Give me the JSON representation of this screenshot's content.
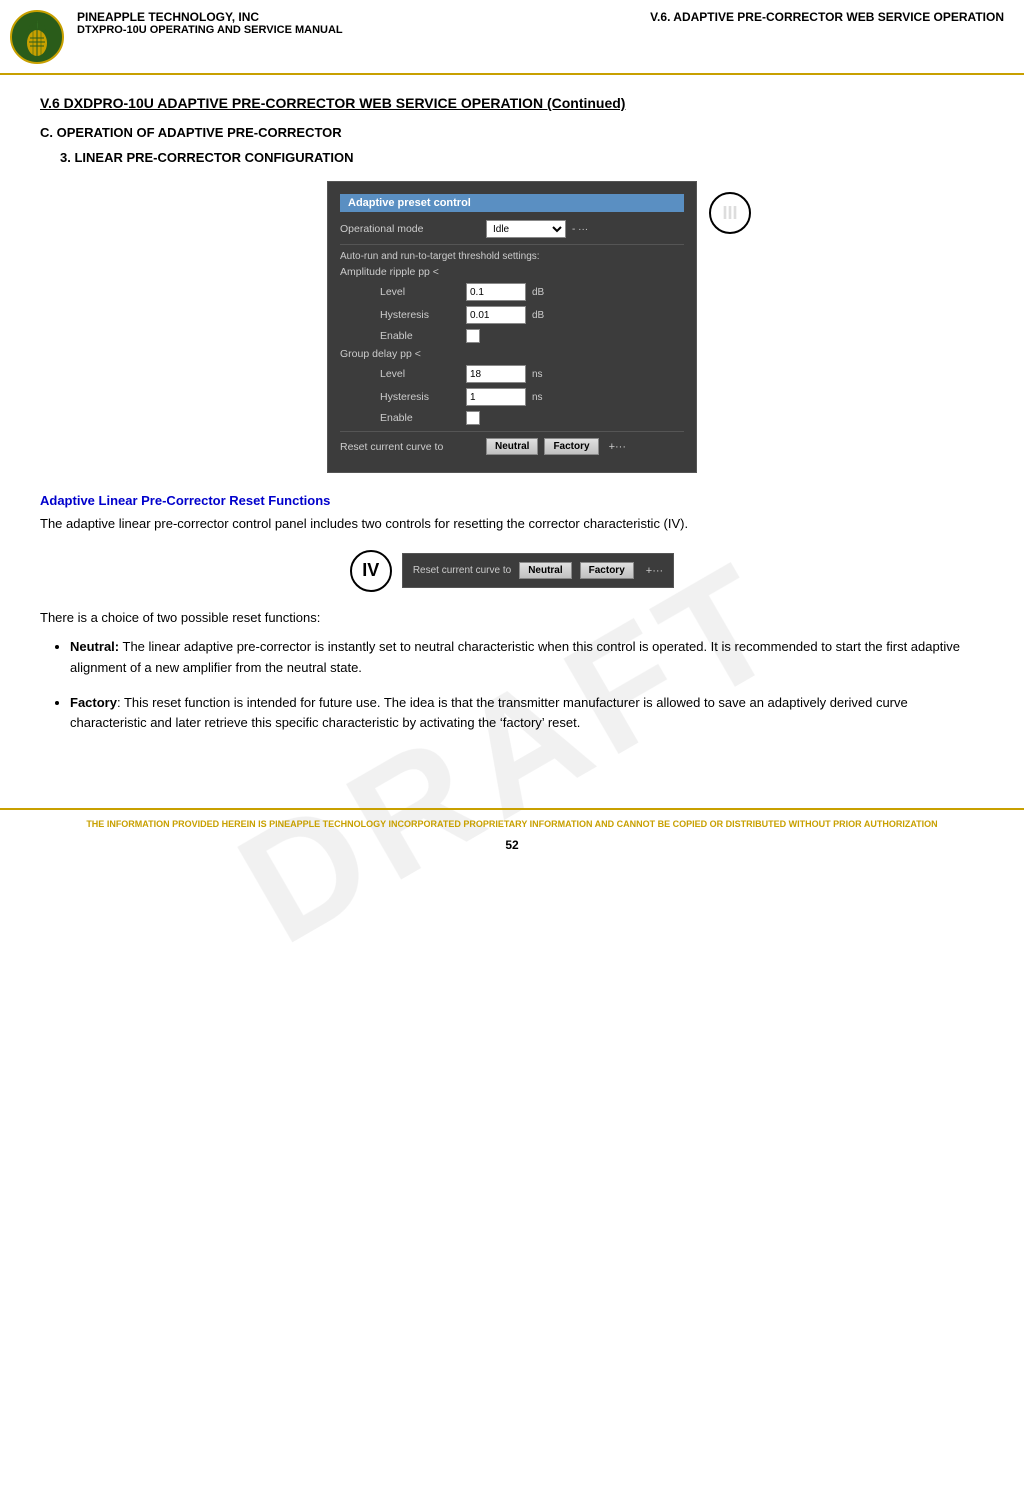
{
  "header": {
    "company": "PINEAPPLE TECHNOLOGY, INC",
    "chapter": "V.6. ADAPTIVE PRE-CORRECTOR WEB SERVICE OPERATION",
    "manual": "DTXPRO-10U OPERATING AND SERVICE MANUAL"
  },
  "section_title": "V.6  DXDPRO-10U ADAPTIVE PRE-CORRECTOR WEB SERVICE OPERATION (Continued)",
  "sub_section_c": "C.   OPERATION OF ADAPTIVE PRE-CORRECTOR",
  "sub_section_3": "3.  LINEAR PRE-CORRECTOR CONFIGURATION",
  "ui_panel": {
    "title": "Adaptive preset control",
    "operational_mode_label": "Operational mode",
    "operational_mode_value": "Idle",
    "autorun_label": "Auto-run and run-to-target threshold settings:",
    "amplitude_label": "Amplitude ripple pp <",
    "level_label": "Level",
    "amplitude_level_value": "0.1",
    "amplitude_level_unit": "dB",
    "hysteresis_label": "Hysteresis",
    "amplitude_hysteresis_value": "0.01",
    "amplitude_hysteresis_unit": "dB",
    "enable_label": "Enable",
    "group_delay_label": "Group delay pp <",
    "group_level_value": "18",
    "group_level_unit": "ns",
    "group_hysteresis_value": "1",
    "group_hysteresis_unit": "ns",
    "reset_label": "Reset current curve to",
    "neutral_btn": "Neutral",
    "factory_btn": "Factory",
    "more_dots": "+···"
  },
  "callout_III": "III",
  "callout_IV": "IV",
  "reset_functions_heading": "Adaptive Linear Pre-Corrector Reset Functions",
  "reset_functions_body": "The adaptive linear pre-corrector control panel includes two controls for resetting the corrector characteristic (IV).",
  "iv_reset_label": "Reset current curve to",
  "iv_neutral_btn": "Neutral",
  "iv_factory_btn": "Factory",
  "iv_more_dots": "+···",
  "two_reset_intro": "There is a choice of two possible reset functions:",
  "bullet_neutral_label": "Neutral:",
  "bullet_neutral_text": "The linear adaptive pre-corrector is instantly set to neutral characteristic when this control is operated. It is recommended to start the first adaptive alignment of a new amplifier from the neutral state.",
  "bullet_factory_label": "Factory",
  "bullet_factory_text": ": This reset function is intended for future use. The idea is that the transmitter manufacturer is allowed to save an adaptively derived curve characteristic and later retrieve this specific characteristic by activating the ‘factory’ reset.",
  "footer_text": "THE INFORMATION PROVIDED HEREIN IS PINEAPPLE TECHNOLOGY INCORPORATED PROPRIETARY INFORMATION AND CANNOT BE COPIED OR DISTRIBUTED WITHOUT PRIOR AUTHORIZATION",
  "page_number": "52"
}
